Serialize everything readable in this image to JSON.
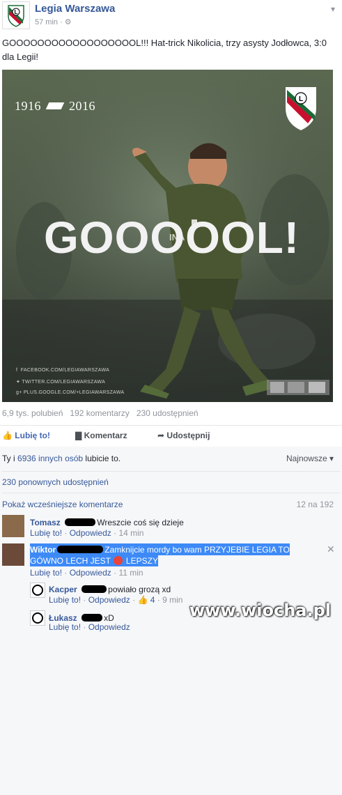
{
  "post": {
    "page_name": "Legia Warszawa",
    "time": "57 min · ",
    "text": "GOOOOOOOOOOOOOOOOOOL!!! Hat-trick Nikolicia, trzy asysty Jodłowca, 3:0 dla Legii!"
  },
  "photo": {
    "years_left": "1916",
    "years_right": "2016",
    "headline": "GOOOOOL!",
    "socials": [
      "FACEBOOK.COM/LEGIAWARSZAWA",
      "TWITTER.COM/LEGIAWARSZAWA",
      "PLUS.GOOGLE.COM/+LEGIAWARSZAWA"
    ]
  },
  "stats": {
    "likes": "6,9 tys. polubień",
    "comments": "192 komentarzy",
    "shares": "230 udostępnień"
  },
  "actions": {
    "like": "Lubię to!",
    "comment": "Komentarz",
    "share": "Udostępnij"
  },
  "likes_summary": {
    "prefix": "Ty i ",
    "others": "6936 innych osób",
    "suffix": " lubicie to.",
    "sort": "Najnowsze"
  },
  "reshares": "230 ponownych udostępnień",
  "comments_header": {
    "prev": "Pokaż wcześniejsze komentarze",
    "count": "12 na 192"
  },
  "comments": [
    {
      "name": "Tomasz",
      "text": "Wreszcie coś się dzieje",
      "like": "Lubię to!",
      "reply": "Odpowiedz",
      "time": "14 min"
    },
    {
      "name": "Wiktor",
      "text1": "Zamknijcie mordy bo wam PRZYJEBIE LEGIA TO",
      "text2a": "GÓWNO LECH JEST",
      "text2b": "LEPSZY",
      "like": "Lubię to!",
      "reply": "Odpowiedz",
      "time": "11 min"
    },
    {
      "name": "Kacper",
      "text": "powiało grozą xd",
      "like": "Lubię to!",
      "reply": "Odpowiedz",
      "likes": "4",
      "time": "· 9 min"
    },
    {
      "name": "Łukasz",
      "text": "xD",
      "like": "Lubię to!",
      "reply": "Odpowiedz"
    }
  ],
  "watermark": "www.wiocha.pl",
  "colors": {
    "link": "#365899",
    "highlight": "#3d8af7",
    "kit": "#4a5631"
  }
}
